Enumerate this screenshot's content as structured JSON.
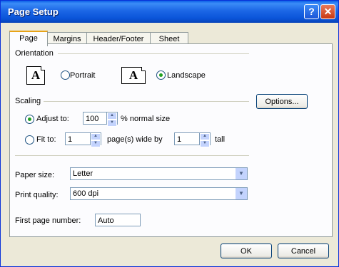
{
  "window": {
    "title": "Page Setup",
    "help_label": "?",
    "close_label": "✕"
  },
  "tabs": [
    {
      "label": "Page",
      "selected": true
    },
    {
      "label": "Margins",
      "selected": false
    },
    {
      "label": "Header/Footer",
      "selected": false
    },
    {
      "label": "Sheet",
      "selected": false
    }
  ],
  "orientation": {
    "group_label": "Orientation",
    "portrait_label": "Portrait",
    "landscape_label": "Landscape",
    "selected": "landscape",
    "icon_letter": "A"
  },
  "scaling": {
    "group_label": "Scaling",
    "adjust_label": "Adjust to:",
    "adjust_value": "100",
    "adjust_suffix": "% normal size",
    "fit_label": "Fit to:",
    "fit_wide_value": "1",
    "fit_wide_suffix": "page(s) wide by",
    "fit_tall_value": "1",
    "fit_tall_suffix": "tall",
    "selected": "adjust"
  },
  "paper_size": {
    "label": "Paper size:",
    "value": "Letter"
  },
  "print_quality": {
    "label": "Print quality:",
    "value": "600 dpi"
  },
  "first_page": {
    "label": "First page number:",
    "value": "Auto"
  },
  "buttons": {
    "options": "Options...",
    "ok": "OK",
    "cancel": "Cancel"
  }
}
